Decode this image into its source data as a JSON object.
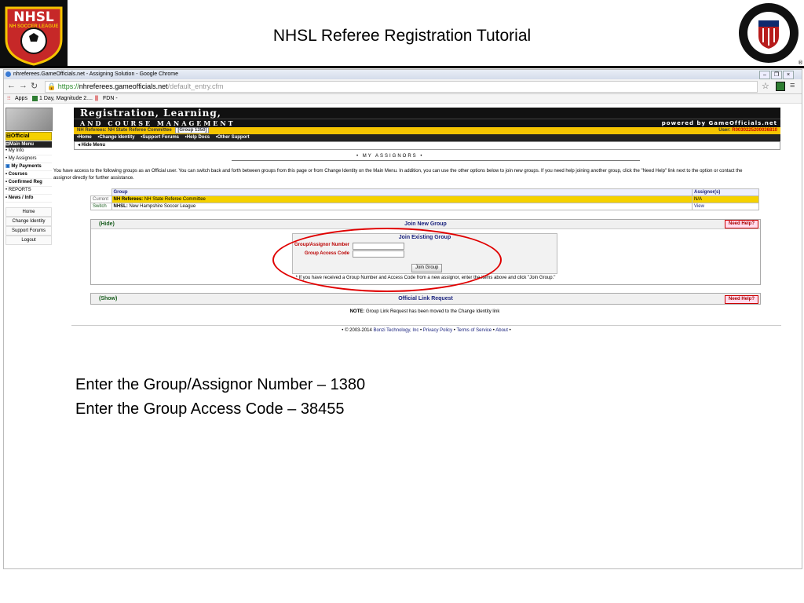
{
  "slide": {
    "title": "NHSL Referee Registration Tutorial",
    "logo_left_text": "NHSL",
    "logo_left_sub": "NH SOCCER LEAGUE",
    "logo_right_text": "U.S. SOCCER FEDERATION REFEREE PROGRAM",
    "instructions": [
      "Enter the Group/Assignor Number – 1380",
      "Enter the Group Access Code – 38455"
    ]
  },
  "browser": {
    "window_title": "nhreferees.GameOfficials.net - Assigning Solution - Google Chrome",
    "url_scheme": "https://",
    "url_host": "nhreferees.gameofficials.net",
    "url_path": "/default_entry.cfm",
    "bookmarks": [
      "Apps",
      "1 Day, Magnitude 2....",
      "FDN -"
    ]
  },
  "sidebar": {
    "role": "Official",
    "menu_title": "Main Menu",
    "items": [
      "My Info",
      "My Assignors",
      "My Payments",
      "Courses",
      "Confirmed Reg",
      "REPORTS",
      "News / Info"
    ],
    "links": [
      "Home",
      "Change Identity",
      "Support Forums",
      "Logout"
    ]
  },
  "header": {
    "line1": "Registration, Learning,",
    "line2": "and Course Management",
    "powered_by": "powered by GameOfficials.net",
    "group_line": "NH Referees: NH State Referee Committee",
    "group_tag": "[Group 1350]",
    "user_label": "User:",
    "user_id": "R0030225200036810",
    "nav": [
      "•Home",
      "•Change Identity",
      "•Support Forums",
      "•Help Docs",
      "•Other Support"
    ],
    "hide_menu": "◂ Hide Menu"
  },
  "main": {
    "section_title": "• MY ASSIGNORS •",
    "intro": "You have access to the following groups as an Official user. You can switch back and forth between groups from this page or from Change Identity on the Main Menu. In addition, you can use the other options below to join new groups. If you need help joining another group, click the \"Need Help\" link next to the option or contact the assignor directly for further assistance.",
    "table": {
      "headers": [
        "",
        "Group",
        "Assignor(s)"
      ],
      "rows": [
        {
          "action": "Current",
          "prefix": "NH Referees:",
          "name": "NH State Referee Committee",
          "assignor": "N/A"
        },
        {
          "action": "Switch",
          "prefix": "NHSL:",
          "name": "New Hampshire Soccer League",
          "assignor": "View"
        }
      ]
    },
    "join": {
      "hide": "(Hide)",
      "title": "Join New Group",
      "need_help": "Need Help?",
      "existing_title": "Join Existing Group",
      "number_label": "Group/Assignor Number",
      "code_label": "Group Access Code",
      "number_value": "",
      "code_value": "",
      "button": "Join Group",
      "note": "* If you have received a Group Number and Access Code from a new assignor, enter the items above and click \"Join Group.\""
    },
    "link_request": {
      "show": "(Show)",
      "title": "Official Link Request",
      "need_help": "Need Help?",
      "note_bold": "NOTE:",
      "note": "Group Link Request has been moved to the Change Identity link"
    },
    "footer": {
      "copyright": "© 2003-2014",
      "company": "Bonzi Technology, Inc",
      "links": [
        "Privacy Policy",
        "Terms of Service",
        "About"
      ]
    }
  }
}
